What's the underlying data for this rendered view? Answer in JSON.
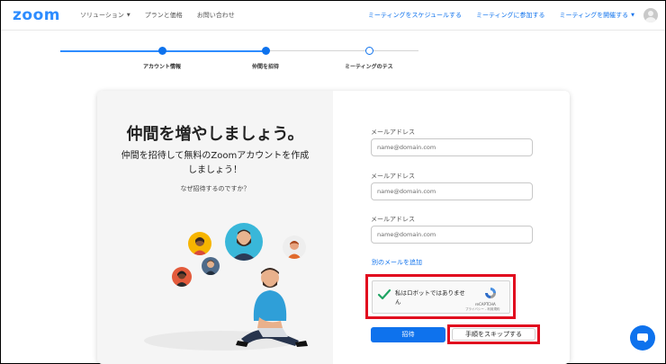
{
  "header": {
    "logo": "zoom",
    "nav_left": [
      {
        "label": "ソリューション",
        "dropdown": true
      },
      {
        "label": "プランと価格",
        "dropdown": false
      },
      {
        "label": "お問い合わせ",
        "dropdown": false
      }
    ],
    "nav_right": [
      {
        "label": "ミーティングをスケジュールする",
        "dropdown": false
      },
      {
        "label": "ミーティングに参加する",
        "dropdown": false
      },
      {
        "label": "ミーティングを開催する",
        "dropdown": true
      }
    ],
    "avatar_icon": "user-avatar-icon"
  },
  "stepper": {
    "steps": [
      {
        "label": "アカウント情報",
        "status": "done"
      },
      {
        "label": "仲間を招待",
        "status": "current"
      },
      {
        "label": "ミーティングのテス",
        "status": "todo"
      }
    ]
  },
  "left_panel": {
    "headline": "仲間を増やしましょう。",
    "subline_1": "仲間を招待して無料のZoomアカウントを作成",
    "subline_2": "しましょう！",
    "why_link": "なぜ招待するのですか？"
  },
  "form": {
    "fields": [
      {
        "label": "メールアドレス",
        "placeholder": "name@domain.com",
        "value": ""
      },
      {
        "label": "メールアドレス",
        "placeholder": "name@domain.com",
        "value": ""
      },
      {
        "label": "メールアドレス",
        "placeholder": "name@domain.com",
        "value": ""
      }
    ],
    "add_email_link": "別のメールを追加",
    "captcha": {
      "text": "私はロボットではありません",
      "checked": true,
      "brand": "reCAPTCHA",
      "terms": "プライバシー - 利用規約"
    },
    "invite_button": "招待",
    "skip_button": "手順をスキップする"
  },
  "colors": {
    "brand": "#2d8cff",
    "primary": "#0e72ed",
    "highlight": "#e10a1e",
    "check": "#1fa463"
  },
  "chat_fab_icon": "chat-bubble-icon"
}
